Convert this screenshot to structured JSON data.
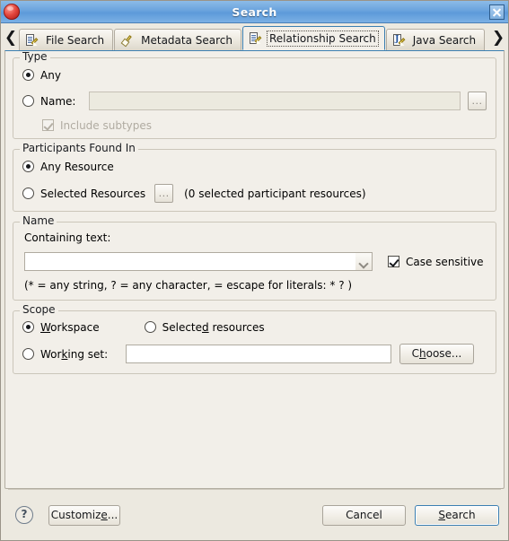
{
  "window": {
    "title": "Search",
    "app_icon": "app-icon",
    "close_icon": "close-icon"
  },
  "tabs": {
    "prev_arrow": "❮",
    "next_arrow": "❯",
    "items": [
      {
        "label": "File Search",
        "icon": "file-search-icon",
        "selected": false
      },
      {
        "label": "Metadata Search",
        "icon": "metadata-search-icon",
        "selected": false
      },
      {
        "label": "Relationship Search",
        "icon": "relationship-search-icon",
        "selected": true
      },
      {
        "label": "Java Search",
        "icon": "java-search-icon",
        "selected": false
      }
    ]
  },
  "type_group": {
    "legend": "Type",
    "any_label": "Any",
    "any_selected": true,
    "name_label": "Name:",
    "name_selected": false,
    "name_value": "",
    "name_browse_label": "...",
    "include_subtypes_label": "Include subtypes",
    "include_subtypes_checked": true,
    "include_subtypes_disabled": true
  },
  "participants_group": {
    "legend": "Participants Found In",
    "any_resource_label": "Any Resource",
    "any_resource_selected": true,
    "selected_resources_label": "Selected Resources",
    "selected_resources_selected": false,
    "browse_label": "...",
    "count_text": "(0 selected participant resources)"
  },
  "name_group": {
    "legend": "Name",
    "containing_text_label": "Containing text:",
    "containing_text_value": "",
    "case_sensitive_label": "Case sensitive",
    "case_sensitive_checked": true,
    "hint": "(* = any string, ? = any character,  = escape for literals: * ? )"
  },
  "scope_group": {
    "legend": "Scope",
    "workspace_label": "Workspace",
    "workspace_mnemonic": "W",
    "workspace_selected": true,
    "selected_resources_label": "Selected resources",
    "selected_resources_pre": "Selecte",
    "selected_resources_mnemonic": "d",
    "selected_resources_post": " resources",
    "selected_resources_selected": false,
    "working_set_pre": "Wor",
    "working_set_mnemonic": "k",
    "working_set_post": "ing set:",
    "working_set_selected": false,
    "working_set_value": "",
    "choose_pre": "C",
    "choose_mnemonic": "h",
    "choose_post": "oose..."
  },
  "footer": {
    "help_icon": "help-icon",
    "help_glyph": "?",
    "customize_pre": "Customiz",
    "customize_mnemonic": "e",
    "customize_post": "...",
    "cancel_label": "Cancel",
    "search_pre": "",
    "search_mnemonic": "S",
    "search_post": "earch"
  },
  "colors": {
    "titlebar": "#6aa3dd",
    "dialog_bg": "#ece9e0",
    "content_bg": "#f2efe9",
    "accent": "#3c7fb1",
    "disabled_text": "#b0aba1"
  }
}
